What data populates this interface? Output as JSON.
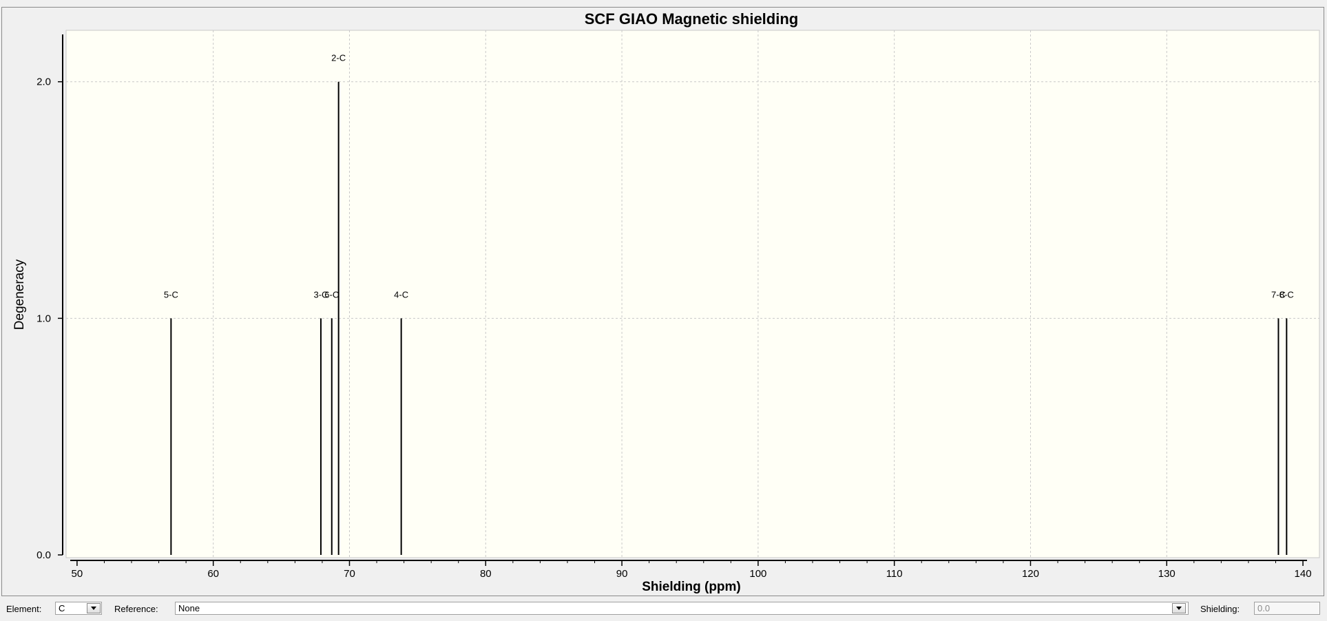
{
  "chart_data": {
    "type": "bar",
    "title": "SCF GIAO Magnetic shielding",
    "xlabel": "Shielding (ppm)",
    "ylabel": "Degeneracy",
    "xlim": [
      49.5,
      140.3
    ],
    "ylim": [
      0,
      2.2
    ],
    "xticks": [
      50,
      60,
      70,
      80,
      90,
      100,
      110,
      120,
      130,
      140
    ],
    "yticks": [
      "0.0",
      "1.0",
      "2.0"
    ],
    "grid": true,
    "peaks": [
      {
        "x": 56.9,
        "y": 1,
        "label": "5-C"
      },
      {
        "x": 67.9,
        "y": 1,
        "label": "3-C"
      },
      {
        "x": 68.7,
        "y": 1,
        "label": "6-C"
      },
      {
        "x": 69.2,
        "y": 2,
        "label": "2-C"
      },
      {
        "x": 73.8,
        "y": 1,
        "label": "4-C"
      },
      {
        "x": 138.2,
        "y": 1,
        "label": "7-C"
      },
      {
        "x": 138.8,
        "y": 1,
        "label": "8-C"
      }
    ]
  },
  "toolbar": {
    "element_label": "Element:",
    "element_value": "C",
    "reference_label": "Reference:",
    "reference_value": "None",
    "shielding_label": "Shielding:",
    "shielding_value": "0.0"
  },
  "colors": {
    "plot_background": "#fffff6",
    "frame_background": "#f0f0f0",
    "grid": "#c8c8c8",
    "peak": "#000000"
  }
}
